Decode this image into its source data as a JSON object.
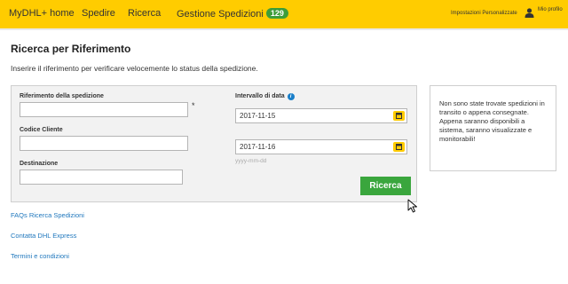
{
  "nav": {
    "home": "MyDHL+ home",
    "ship": "Spedire",
    "search": "Ricerca",
    "manage": "Gestione Spedizioni",
    "manage_count": "129",
    "settings": "Impostazioni Personalizzate",
    "profile": "Mio profilo"
  },
  "page": {
    "title": "Ricerca per Riferimento",
    "intro": "Inserire il riferimento per verificare velocemente lo status della spedizione."
  },
  "form": {
    "reference_label": "Riferimento della spedizione",
    "reference_value": "",
    "required_mark": "*",
    "customer_code_label": "Codice Cliente",
    "customer_code_value": "",
    "destination_label": "Destinazione",
    "destination_value": "",
    "date_range_label": "Intervallo di data",
    "date_from": "2017-11-15",
    "date_to": "2017-11-16",
    "date_format_hint": "yyyy-mm-dd",
    "search_button": "Ricerca"
  },
  "notice": {
    "text": "Non sono state trovate spedizioni in transito o appena consegnate. Appena saranno disponibili a sistema, saranno visualizzate e monitorabili!"
  },
  "links": {
    "faq": "FAQs Ricerca Spedizioni",
    "contact": "Contatta DHL Express",
    "terms": "Termini e condizioni"
  },
  "colors": {
    "brand_yellow": "#ffcc00",
    "button_green": "#3aa63d",
    "link_blue": "#1f77bd"
  }
}
